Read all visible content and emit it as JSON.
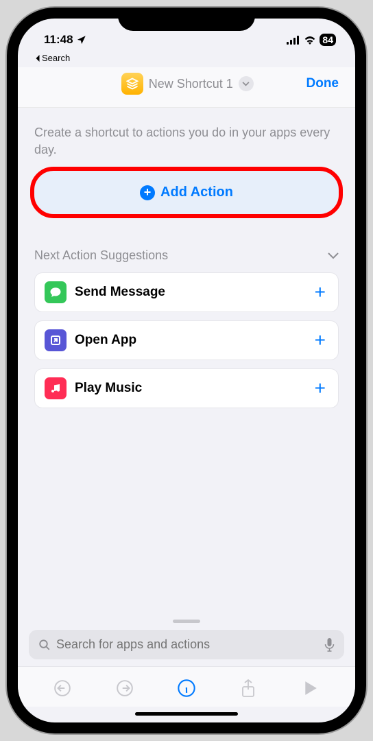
{
  "status": {
    "time": "11:48",
    "battery": "84"
  },
  "back": {
    "label": "Search"
  },
  "nav": {
    "title": "New Shortcut 1",
    "done": "Done"
  },
  "content": {
    "instruction": "Create a shortcut to actions you do in your apps every day.",
    "add_action_label": "Add Action"
  },
  "suggestions": {
    "header": "Next Action Suggestions",
    "items": [
      {
        "label": "Send Message",
        "icon_bg": "#34c759"
      },
      {
        "label": "Open App",
        "icon_bg": "#5856d6"
      },
      {
        "label": "Play Music",
        "icon_bg": "#ff2d55"
      }
    ]
  },
  "search": {
    "placeholder": "Search for apps and actions"
  }
}
